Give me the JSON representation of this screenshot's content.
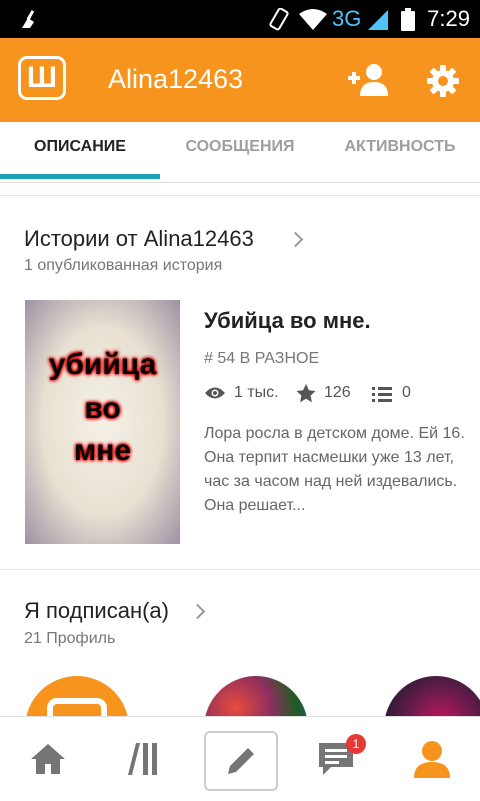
{
  "status_bar": {
    "network": "3G",
    "time": "7:29"
  },
  "header": {
    "username": "Alina12463",
    "logo_letter": "Ш"
  },
  "tabs": [
    {
      "label": "ОПИСАНИЕ",
      "active": true
    },
    {
      "label": "СООБЩЕНИЯ",
      "active": false
    },
    {
      "label": "АКТИВНОСТЬ",
      "active": false
    }
  ],
  "stories": {
    "title": "Истории от Alina12463",
    "subtitle": "1 опубликованная история",
    "items": [
      {
        "cover_text": [
          "убийца",
          "во",
          "мне"
        ],
        "title": "Убийца во мне.",
        "category": "# 54 В РАЗНОЕ",
        "reads": "1 тыс.",
        "votes": "126",
        "parts": "0",
        "description": "Лора росла в детском доме. Ей 16. Она терпит насмешки уже 13 лет, час за часом над ней издевались. Она решает..."
      }
    ]
  },
  "following": {
    "title": "Я подписан(а)",
    "subtitle": "21 Профиль"
  },
  "bottom_nav": {
    "messages_badge": "1"
  },
  "colors": {
    "brand": "#f7941d",
    "accent": "#1aa3b5"
  }
}
